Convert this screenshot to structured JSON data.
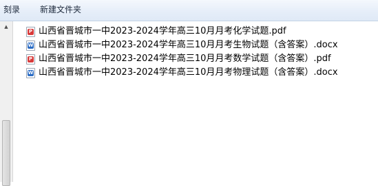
{
  "toolbar": {
    "burn_label": "刻录",
    "new_folder_label": "新建文件夹"
  },
  "scrollbar": {
    "up_arrow": "▲"
  },
  "files": [
    {
      "name": "山西省晋城市一中2023-2024学年高三10月月考化学试题.pdf",
      "type": "pdf",
      "icon_glyph": "P",
      "icon": "pdf-file-icon"
    },
    {
      "name": "山西省晋城市一中2023-2024学年高三10月月考生物试题（含答案）.docx",
      "type": "doc",
      "icon_glyph": "W",
      "icon": "word-file-icon"
    },
    {
      "name": "山西省晋城市一中2023-2024学年高三10月月考数学试题（含答案）.pdf",
      "type": "pdf",
      "icon_glyph": "P",
      "icon": "pdf-file-icon"
    },
    {
      "name": "山西省晋城市一中2023-2024学年高三10月月考物理试题（含答案）.docx",
      "type": "doc",
      "icon_glyph": "W",
      "icon": "word-file-icon"
    }
  ],
  "colors": {
    "pdf_icon": "#d83a3a",
    "word_icon": "#2b6cc4",
    "toolbar_bg": "#e6eef9"
  }
}
